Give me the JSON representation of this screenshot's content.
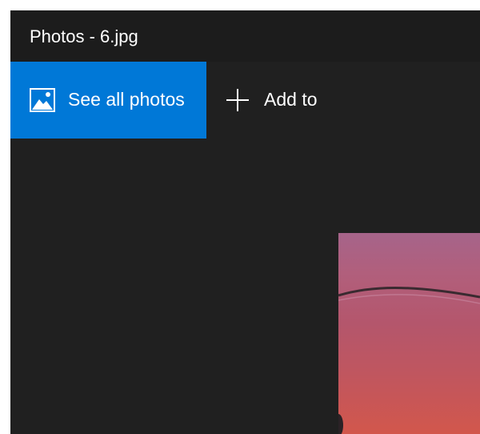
{
  "window": {
    "title": "Photos - 6.jpg"
  },
  "toolbar": {
    "see_all_label": "See all photos",
    "see_all_icon": "photo-icon",
    "add_to_label": "Add to",
    "add_to_icon": "plus-icon"
  },
  "colors": {
    "accent": "#0078d7",
    "background": "#1f1f1f"
  }
}
